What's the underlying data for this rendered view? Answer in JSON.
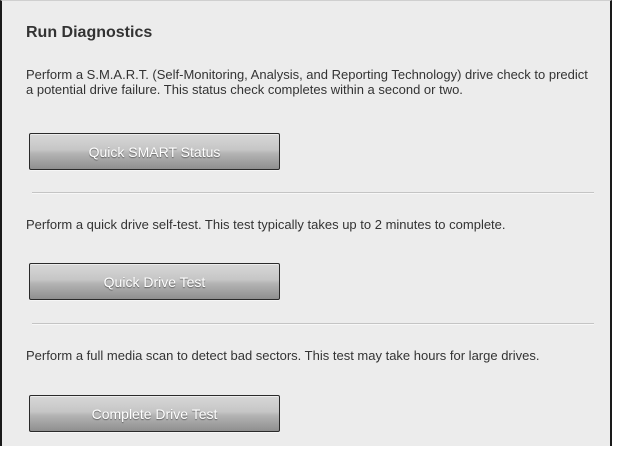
{
  "panel": {
    "title": "Run Diagnostics"
  },
  "sections": [
    {
      "description": "Perform a S.M.A.R.T. (Self-Monitoring, Analysis, and Reporting Technology) drive check to predict a potential drive failure. This status check completes within a second or two.",
      "button_label": "Quick SMART Status"
    },
    {
      "description": "Perform a quick drive self-test. This test typically takes up to 2 minutes to complete.",
      "button_label": "Quick Drive Test"
    },
    {
      "description": "Perform a full media scan to detect bad sectors. This test may take hours for large drives.",
      "button_label": "Complete Drive Test"
    }
  ]
}
